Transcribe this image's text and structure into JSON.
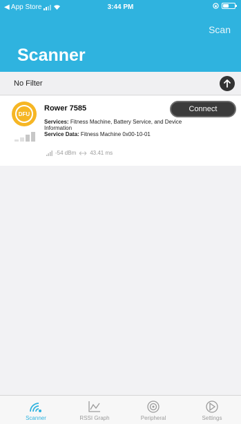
{
  "status_bar": {
    "carrier": "◀ App Store",
    "time": "3:44 PM"
  },
  "header": {
    "scan_label": "Scan",
    "title": "Scanner"
  },
  "filter": {
    "label": "No Filter"
  },
  "device": {
    "badge_text": "DFU",
    "name": "Rower 7585",
    "connect_label": "Connect",
    "services_label": "Services:",
    "services_value": " Fitness Machine, Battery Service, and Device Information",
    "service_data_label": "Service Data:",
    "service_data_value": " Fitness Machine 0x00-10-01",
    "rssi": "-54 dBm",
    "interval": "43.41 ms"
  },
  "tabs": [
    {
      "label": "Scanner",
      "icon": "scanner-icon",
      "active": true
    },
    {
      "label": "RSSI Graph",
      "icon": "graph-icon",
      "active": false
    },
    {
      "label": "Peripheral",
      "icon": "peripheral-icon",
      "active": false
    },
    {
      "label": "Settings",
      "icon": "settings-icon",
      "active": false
    }
  ],
  "colors": {
    "accent": "#2fb3df",
    "dfu_badge": "#f6b624",
    "connect_button": "#3b3b3b"
  }
}
